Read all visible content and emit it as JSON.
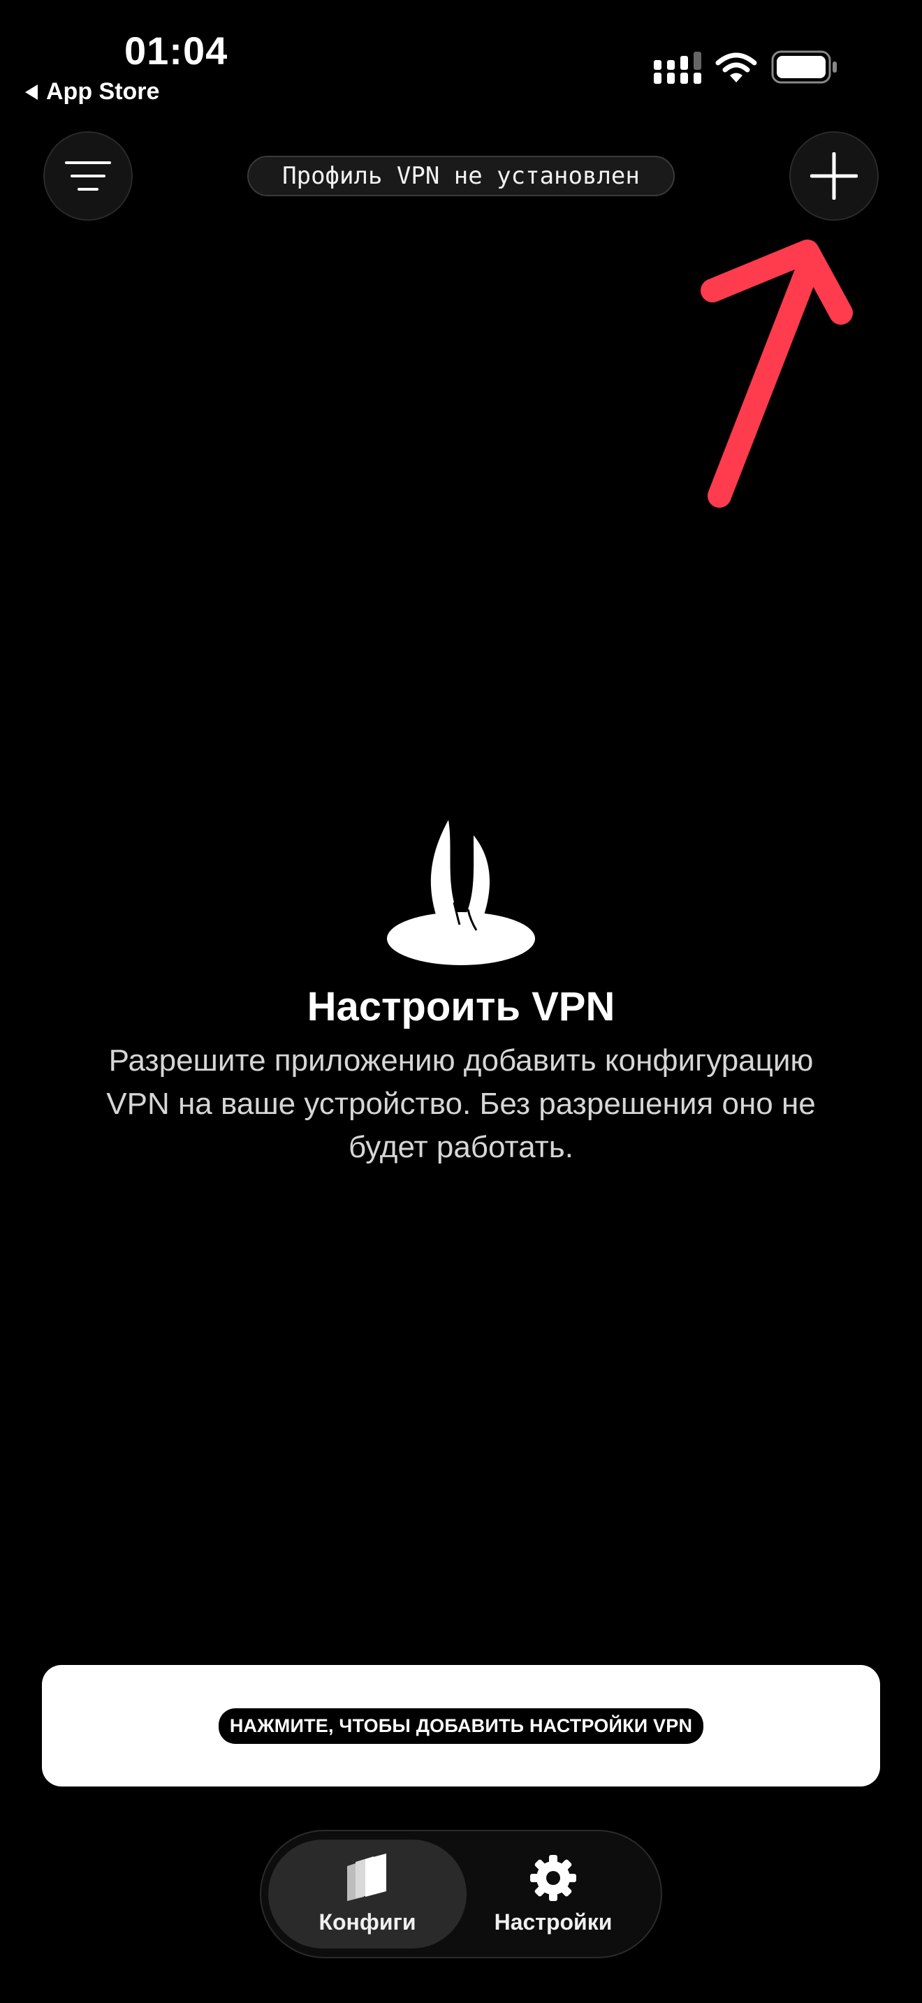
{
  "status_bar": {
    "time": "01:04",
    "back_label": "App Store"
  },
  "header": {
    "vpn_status": "Профиль VPN не установлен"
  },
  "empty_state": {
    "title": "Настроить VPN",
    "description": "Разрешите приложению добавить конфигурацию VPN на ваше устройство. Без разрешения оно не будет работать."
  },
  "cta": {
    "label": "НАЖМИТЕ, ЧТОБЫ ДОБАВИТЬ НАСТРОЙКИ VPN"
  },
  "tabs": [
    {
      "label": "Конфиги",
      "icon": "configs-stack-icon",
      "active": true
    },
    {
      "label": "Настройки",
      "icon": "gear-icon",
      "active": false
    }
  ],
  "colors": {
    "background": "#000000",
    "accent_arrow": "#ff3b4e",
    "card": "#ffffff"
  },
  "icons": {
    "menu": "filter-lines-icon",
    "add": "plus-icon",
    "logo": "rabbit-ears-icon"
  }
}
